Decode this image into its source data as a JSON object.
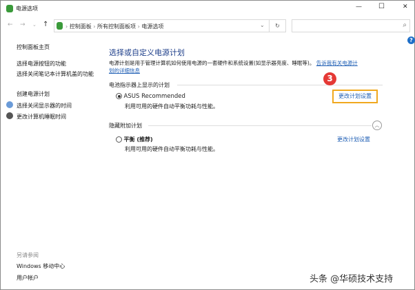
{
  "window": {
    "title": "电源选项",
    "minimize": "—",
    "maximize": "☐",
    "close": "✕"
  },
  "address": {
    "crumbs": [
      "控制面板",
      "所有控制面板项",
      "电源选项"
    ],
    "dropdown": "⌄",
    "refresh": "↻",
    "search_placeholder": "",
    "search_icon": "⌕"
  },
  "sidebar": {
    "home": "控制面板主页",
    "items": [
      "选择电源按钮的功能",
      "选择关闭笔记本计算机盖的功能",
      "创建电源计划",
      "选择关闭显示器的时间",
      "更改计算机睡眠时间"
    ],
    "see_also": "另请参阅",
    "see_also_items": [
      "Windows 移动中心",
      "用户帐户"
    ]
  },
  "main": {
    "title": "选择或自定义电源计划",
    "desc": "电源计划是用于管理计算机如何使用电源的一套硬件和系统设置(如显示器亮度、睡眠等)。",
    "desc_link1": "告诉我有关电源计",
    "desc_link2": "划的详细信息",
    "section1": "电池指示器上显示的计划",
    "plan1_name": "ASUS Recommended",
    "plan1_desc": "利用可用的硬件自动平衡功耗与性能。",
    "plan1_link": "更改计划设置",
    "section2": "隐藏附加计划",
    "plan2_name": "平衡 (推荐)",
    "plan2_desc": "利用可用的硬件自动平衡功耗与性能。",
    "plan2_link": "更改计划设置",
    "step_badge": "3",
    "help": "?"
  },
  "watermark": "头条 @华硕技术支持",
  "colors": {
    "accent": "#1e5eb4",
    "highlight": "#f0a81e",
    "badge": "#e53935"
  }
}
